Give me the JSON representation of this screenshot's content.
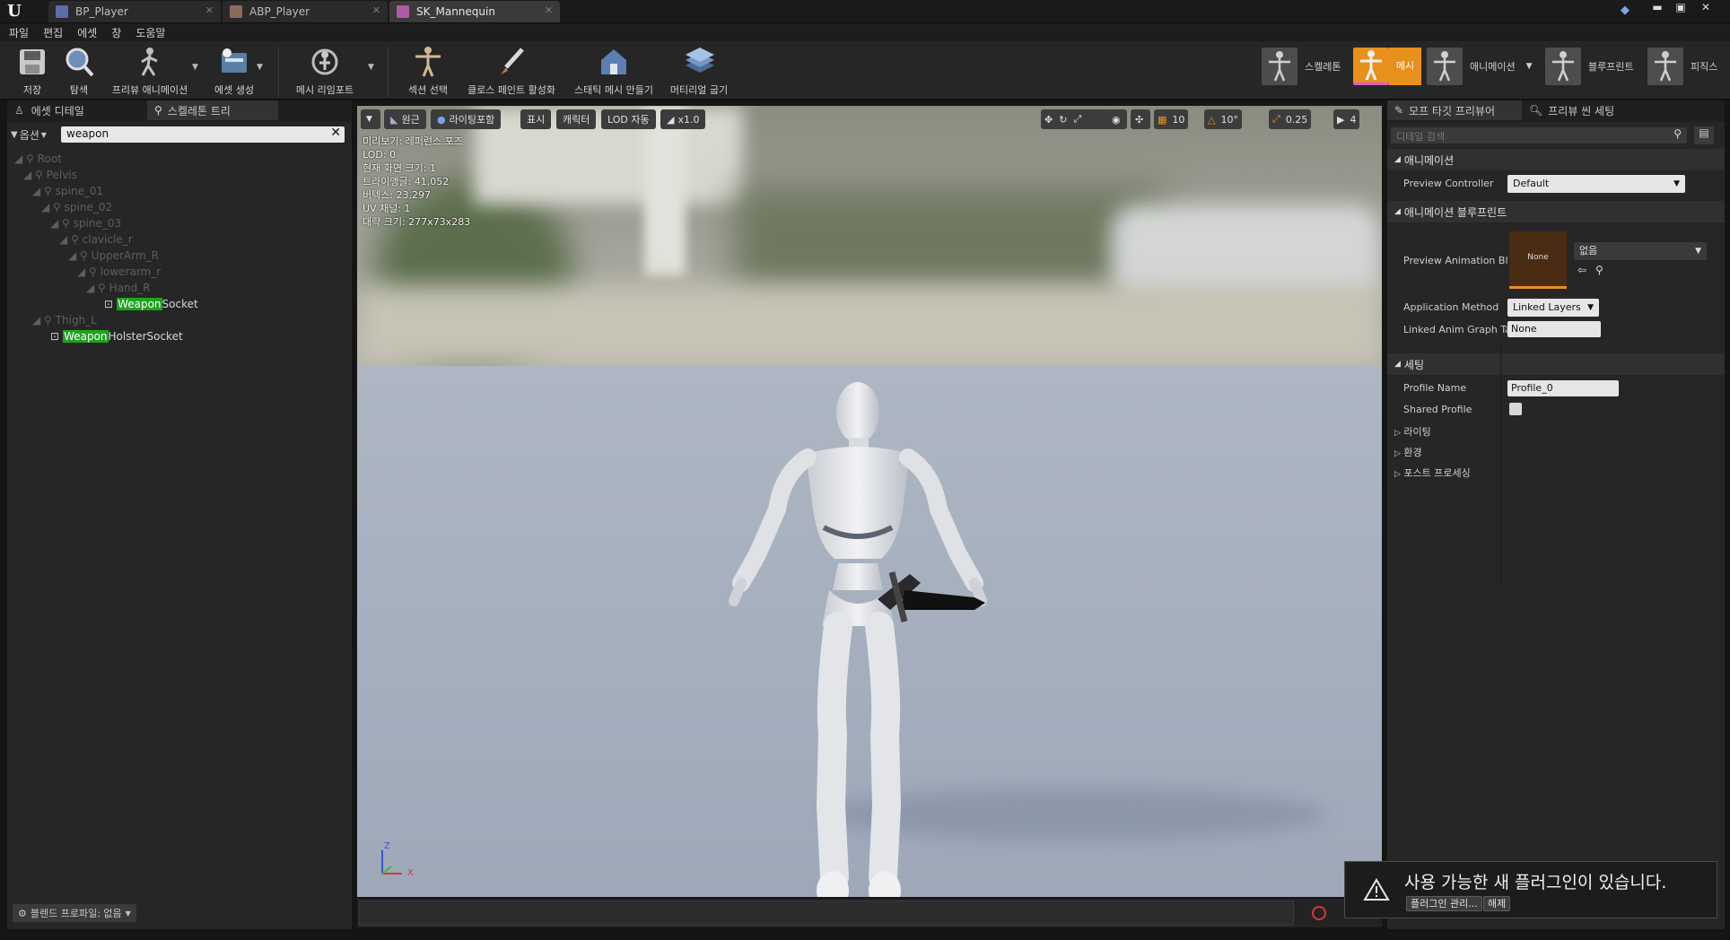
{
  "tabs": [
    {
      "label": "BP_Player",
      "icon": "blueprint-icon"
    },
    {
      "label": "ABP_Player",
      "icon": "anim-blueprint-icon"
    },
    {
      "label": "SK_Mannequin",
      "icon": "skeletal-mesh-icon"
    }
  ],
  "window_controls": {
    "minimize": "▬",
    "maximize": "▣",
    "close": "✕"
  },
  "menu": [
    "파일",
    "편집",
    "에셋",
    "창",
    "도움말"
  ],
  "toolbar": {
    "save": "저장",
    "browse": "탐색",
    "preview_anim": "프리뷰 애니메이션",
    "make_asset": "에셋 생성",
    "mesh_reimport": "메시 리임포트",
    "section_select": "섹션 선택",
    "cloth_paint": "클로스 페인트 활성화",
    "static_mesh": "스태틱 메시 만들기",
    "bake_material": "머티리얼 굽기"
  },
  "modes": {
    "skeleton": "스켈레톤",
    "mesh": "메시",
    "animation": "애니메이션",
    "blueprint": "블루프린트",
    "physics": "피직스"
  },
  "left_panel": {
    "tab_asset_details": "에셋 디테일",
    "tab_skeleton_tree": "스켈레톤 트리",
    "options_label": "옵션",
    "search_value": "weapon",
    "bones": [
      "Root",
      "Pelvis",
      "spine_01",
      "spine_02",
      "spine_03",
      "clavicle_r",
      "UpperArm_R",
      "lowerarm_r",
      "Hand_R"
    ],
    "socket1": {
      "highlight": "Weapon",
      "rest": "Socket"
    },
    "thigh": "Thigh_L",
    "socket2": {
      "highlight": "Weapon",
      "rest": "HolsterSocket"
    },
    "blend_profile": "블렌드 프로파일: 없음"
  },
  "viewport": {
    "view_mode": "원근",
    "lighting": "라이팅포함",
    "show": "표시",
    "character": "캐릭터",
    "lod": "LOD 자동",
    "speed": "x1.0",
    "grid_snap": "10",
    "rot_snap": "10°",
    "scale_snap": "0.25",
    "cam_speed": "4",
    "stats": [
      "미리보기: 레퍼런스 포즈",
      "LOD: 0",
      "현재 화면 크기: 1",
      "트라이앵글: 41,052",
      "버텍스: 23,297",
      "UV 채널: 1",
      "대략 크기: 277x73x283"
    ],
    "axis_z": "Z",
    "axis_x": "X"
  },
  "right_panel": {
    "tab_morph": "모프 타깃 프리뷰어",
    "tab_scene": "프리뷰 씬 세팅",
    "search_placeholder": "디테일 검색",
    "section_animation": "애니메이션",
    "preview_controller_label": "Preview Controller",
    "preview_controller_value": "Default",
    "section_anim_bp": "애니메이션 블루프린트",
    "preview_anim_bp_label": "Preview Animation Bl",
    "thumb_label": "None",
    "anim_bp_value": "없음",
    "application_method_label": "Application Method",
    "application_method_value": "Linked Layers",
    "linked_anim_label": "Linked Anim Graph Ta",
    "linked_anim_value": "None",
    "section_settings": "세팅",
    "profile_name_label": "Profile Name",
    "profile_name_value": "Profile_0",
    "shared_profile_label": "Shared Profile",
    "lighting": "라이팅",
    "environment": "환경",
    "post_process": "포스트 프로세싱"
  },
  "notification": {
    "text": "사용 가능한 새 플러그인이 있습니다.",
    "manage": "플러그인 관리...",
    "dismiss": "해제"
  },
  "colors": {
    "accent_orange": "#e8901c",
    "highlight_green": "#1ea31e",
    "mesh_pink": "#d85cc6"
  }
}
